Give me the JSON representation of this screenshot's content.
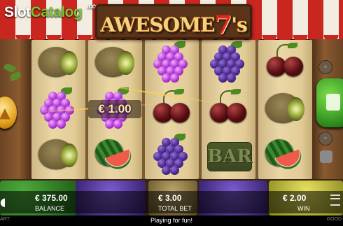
{
  "watermark": {
    "part1": "Slot",
    "part2": "Catalog",
    "part3": ".com"
  },
  "game": {
    "title_part1": "AWESOME",
    "title_seven": "7",
    "title_part2": "'s"
  },
  "reels": [
    [
      "kiwi",
      "grapes-purple",
      "kiwi"
    ],
    [
      "kiwi",
      "grapes-purple",
      "watermelon"
    ],
    [
      "grapes-purple",
      "cherries",
      "grapes-dark"
    ],
    [
      "grapes-dark",
      "cherries",
      "bar"
    ],
    [
      "cherries",
      "kiwi",
      "watermelon"
    ]
  ],
  "win_amount": "€ 1.00",
  "bar_symbol_label": "BAR",
  "hud": {
    "balance_value": "€ 375.00",
    "balance_label": "BALANCE",
    "total_bet_value": "€ 3.00",
    "total_bet_label": "TOTAL BET",
    "win_value": "€ 2.00",
    "win_label": "WIN"
  },
  "status": {
    "message": "Playing for fun!",
    "left_small": "ART",
    "right_small": "GOOD"
  },
  "colors": {
    "awning_red": "#c8261e",
    "awning_white": "#f3ece0",
    "spin_green": "#3fa028",
    "hud_bg": "#000000"
  }
}
